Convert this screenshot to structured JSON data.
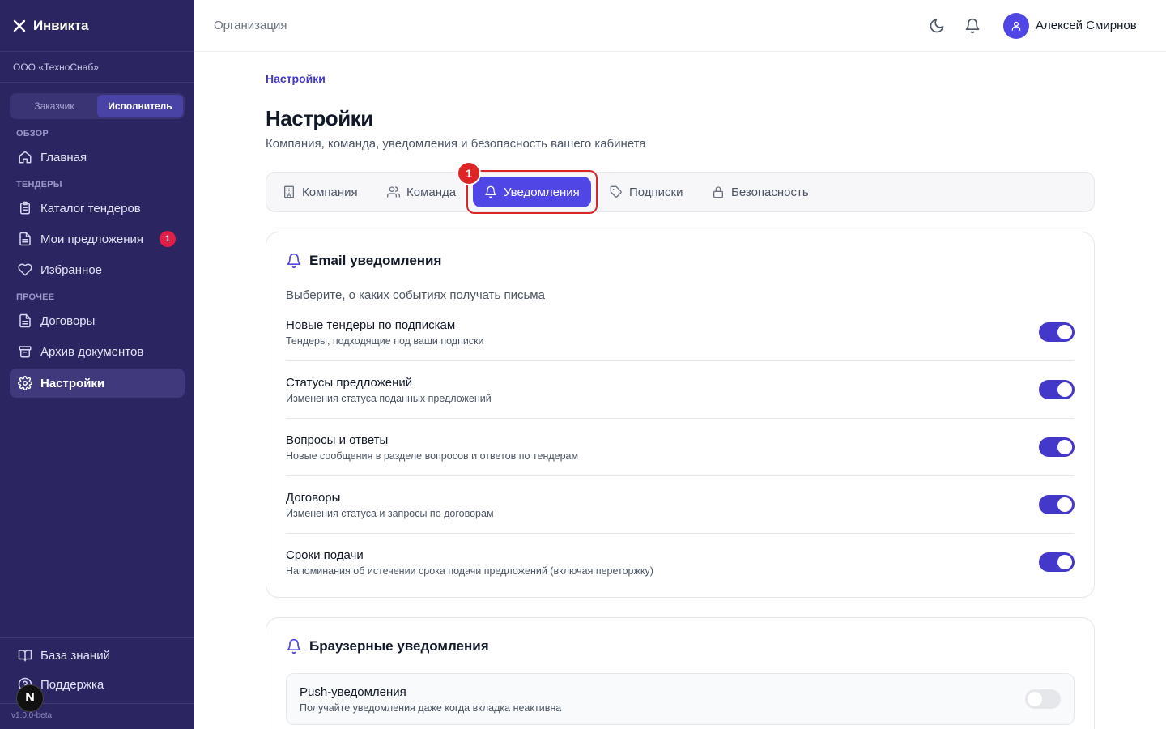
{
  "app": {
    "name": "Инвикта",
    "org": "ООО «ТехноСнаб»",
    "version": "v1.0.0-beta",
    "n_badge": "N"
  },
  "role_switch": {
    "customer": "Заказчик",
    "contractor": "Исполнитель",
    "active": "contractor"
  },
  "sidebar": {
    "sections": {
      "overview": "ОБЗОР",
      "tenders": "ТЕНДЕРЫ",
      "other": "ПРОЧЕЕ"
    },
    "items": {
      "home": "Главная",
      "catalog": "Каталог тендеров",
      "proposals": "Мои предложения",
      "proposals_badge": "1",
      "favorites": "Избранное",
      "contracts": "Договоры",
      "archive": "Архив документов",
      "settings": "Настройки"
    },
    "bottom": {
      "knowledge": "База знаний",
      "support": "Поддержка"
    }
  },
  "header": {
    "title": "Организация",
    "user_name": "Алексей Смирнов"
  },
  "page": {
    "breadcrumb": "Настройки",
    "title": "Настройки",
    "subtitle": "Компания, команда, уведомления и безопасность вашего кабинета"
  },
  "tabs": {
    "company": "Компания",
    "team": "Команда",
    "notifications": "Уведомления",
    "subscriptions": "Подписки",
    "security": "Безопасность",
    "active": "notifications",
    "marker": "1"
  },
  "email_card": {
    "title": "Email уведомления",
    "description": "Выберите, о каких событиях получать письма",
    "rows": [
      {
        "label": "Новые тендеры по подпискам",
        "hint": "Тендеры, подходящие под ваши подписки",
        "enabled": true
      },
      {
        "label": "Статусы предложений",
        "hint": "Изменения статуса поданных предложений",
        "enabled": true
      },
      {
        "label": "Вопросы и ответы",
        "hint": "Новые сообщения в разделе вопросов и ответов по тендерам",
        "enabled": true
      },
      {
        "label": "Договоры",
        "hint": "Изменения статуса и запросы по договорам",
        "enabled": true
      },
      {
        "label": "Сроки подачи",
        "hint": "Напоминания об истечении срока подачи предложений (включая переторжку)",
        "enabled": true
      }
    ]
  },
  "browser_card": {
    "title": "Браузерные уведомления",
    "push": {
      "label": "Push-уведомления",
      "hint": "Получайте уведомления даже когда вкладка неактивна",
      "enabled": false
    }
  },
  "colors": {
    "sidebar_bg": "#2b2561",
    "accent": "#4f46e5",
    "highlight": "#dc2626",
    "badge": "#e11d48"
  }
}
